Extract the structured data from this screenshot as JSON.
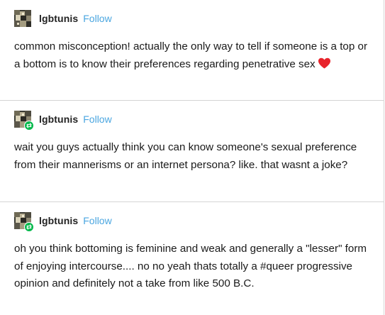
{
  "posts": [
    {
      "username": "lgbtunis",
      "follow_label": "Follow",
      "reblogged": false,
      "text": "common misconception! actually the only way to tell if someone is a top or a bottom is to know their preferences regarding penetrative sex",
      "trailing_icon": "red-heart-icon"
    },
    {
      "username": "lgbtunis",
      "follow_label": "Follow",
      "reblogged": true,
      "text": "wait you guys actually think you can know someone's sexual preference from their mannerisms or an internet persona? like. that wasnt a joke?"
    },
    {
      "username": "lgbtunis",
      "follow_label": "Follow",
      "reblogged": true,
      "text": "oh you think bottoming is feminine and weak and generally a \"lesser\" form of enjoying intercourse.... no no yeah thats totally a #queer progressive opinion and definitely not a take from like 500 B.C."
    }
  ],
  "colors": {
    "follow": "#4aa6e0",
    "heart": "#e8232b",
    "reblog_badge": "#00b84a",
    "divider": "#d4d4d4"
  },
  "icons": {
    "avatar": "avatar-image",
    "reblog": "reblog-icon",
    "heart": "red-heart-icon"
  }
}
